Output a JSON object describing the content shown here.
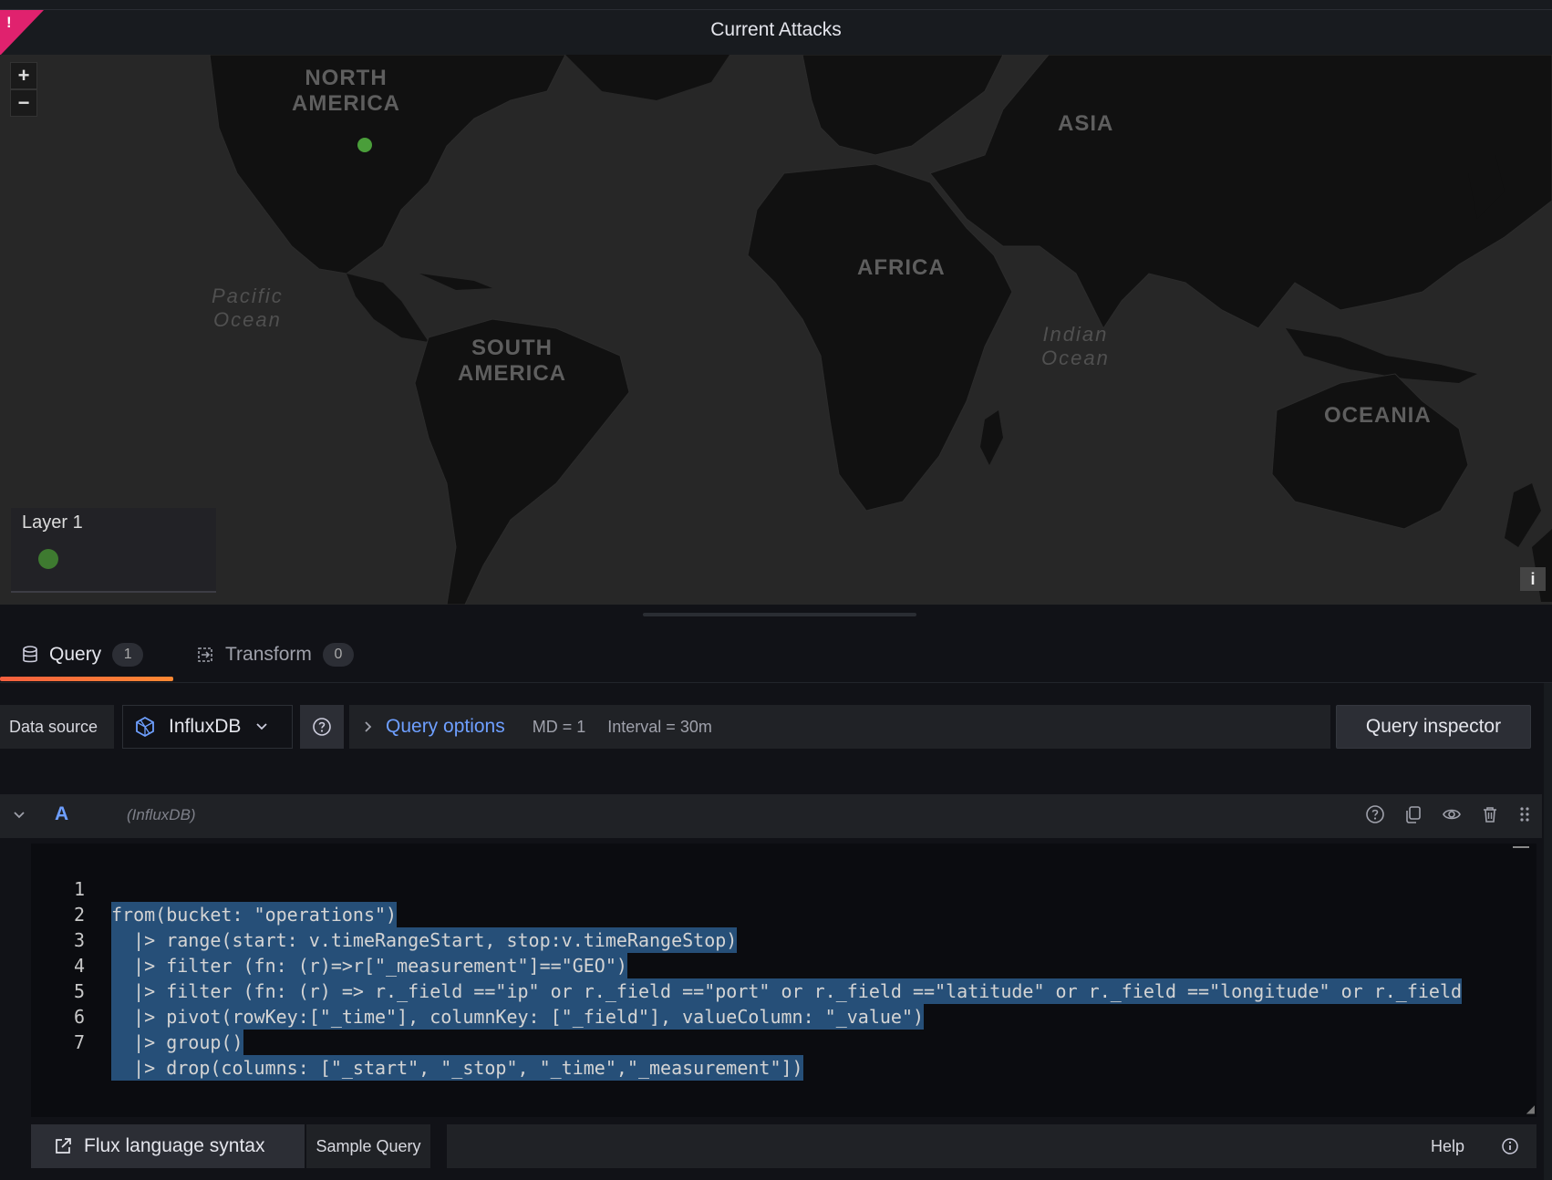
{
  "panel": {
    "title": "Current Attacks",
    "alert_mark": "!"
  },
  "map": {
    "zoom_in": "+",
    "zoom_out": "−",
    "info": "i",
    "continent_labels": {
      "north_america": "NORTH\nAMERICA",
      "south_america": "SOUTH\nAMERICA",
      "africa": "AFRICA",
      "asia": "ASIA",
      "oceania": "OCEANIA"
    },
    "ocean_labels": {
      "pacific": "Pacific\nOcean",
      "indian": "Indian\nOcean"
    },
    "legend": {
      "title": "Layer 1"
    },
    "point_color": "#4a9e3a"
  },
  "tabs": [
    {
      "label": "Query",
      "count": "1",
      "icon": "database-icon"
    },
    {
      "label": "Transform",
      "count": "0",
      "icon": "transform-icon"
    }
  ],
  "datasource": {
    "label": "Data source",
    "selected": "InfluxDB",
    "query_options_label": "Query options",
    "md": "MD = 1",
    "interval": "Interval = 30m",
    "inspector_label": "Query inspector"
  },
  "query": {
    "ref_id": "A",
    "datasource": "(InfluxDB)",
    "lines": [
      "from(bucket: \"operations\")",
      "  |> range(start: v.timeRangeStart, stop:v.timeRangeStop)",
      "  |> filter (fn: (r)=>r[\"_measurement\"]==\"GEO\")",
      "  |> filter (fn: (r) => r._field ==\"ip\" or r._field ==\"port\" or r._field ==\"latitude\" or r._field ==\"longitude\" or r._field",
      "  |> pivot(rowKey:[\"_time\"], columnKey: [\"_field\"], valueColumn: \"_value\")",
      "  |> group()",
      "  |> drop(columns: [\"_start\", \"_stop\", \"_time\",\"_measurement\"])"
    ]
  },
  "bottom": {
    "flux_label": "Flux language syntax",
    "sample_label": "Sample Query",
    "help_label": "Help"
  },
  "colors": {
    "accent": "#6e9fff",
    "tab_underline": "#f55f3e",
    "selection": "#264f78",
    "alert": "#e0226e"
  }
}
